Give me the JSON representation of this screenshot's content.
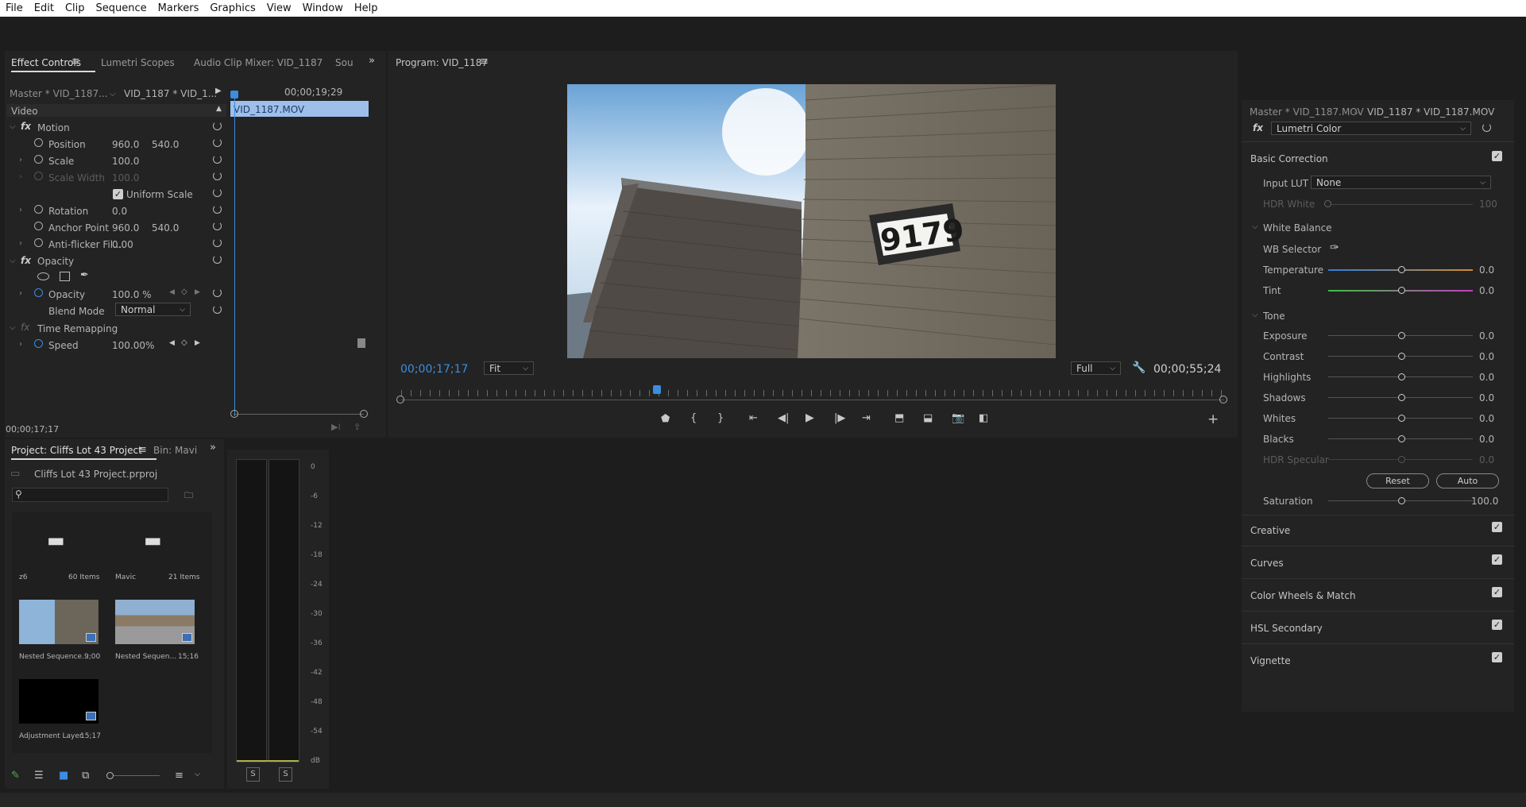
{
  "menu": [
    "File",
    "Edit",
    "Clip",
    "Sequence",
    "Markers",
    "Graphics",
    "View",
    "Window",
    "Help"
  ],
  "effect_controls": {
    "tabs": [
      "Effect Controls",
      "Lumetri Scopes",
      "Audio Clip Mixer: VID_1187",
      "Sou"
    ],
    "master": "Master * VID_1187...",
    "clip": "VID_1187 * VID_1...",
    "timecode_top": "00;00;19;29",
    "clip_bar": "VID_1187.MOV",
    "video_header": "Video",
    "motion": "Motion",
    "position_label": "Position",
    "position_x": "960.0",
    "position_y": "540.0",
    "scale_label": "Scale",
    "scale_value": "100.0",
    "scale_width_label": "Scale Width",
    "scale_width_value": "100.0",
    "uniform_scale": "Uniform Scale",
    "rotation_label": "Rotation",
    "rotation_value": "0.0",
    "anchor_label": "Anchor Point",
    "anchor_x": "960.0",
    "anchor_y": "540.0",
    "antiflicker_label": "Anti-flicker Fil...",
    "antiflicker_value": "0.00",
    "opacity_group": "Opacity",
    "opacity_label": "Opacity",
    "opacity_value": "100.0 %",
    "blend_label": "Blend Mode",
    "blend_value": "Normal",
    "time_remap": "Time Remapping",
    "speed_label": "Speed",
    "speed_value": "100.00%",
    "bottom_timecode": "00;00;17;17"
  },
  "program": {
    "tab": "Program: VID_1187",
    "sign_number": "9179",
    "timecode_current": "00;00;17;17",
    "fit": "Fit",
    "quality": "Full",
    "timecode_duration": "00;00;55;24"
  },
  "project": {
    "tab": "Project: Cliffs Lot 43 Project",
    "tab2": "Bin: Mavi",
    "file": "Cliffs Lot 43 Project.prproj",
    "items": [
      {
        "name": "z6",
        "meta": "60 Items"
      },
      {
        "name": "Mavic",
        "meta": "21 Items"
      },
      {
        "name": "Nested Sequence...",
        "meta": "9;00"
      },
      {
        "name": "Nested Sequen...",
        "meta": "15;16"
      },
      {
        "name": "Adjustment Layer",
        "meta": "15;17"
      }
    ]
  },
  "audio_meter": {
    "scale": [
      "0",
      "-6",
      "-12",
      "-18",
      "-24",
      "-30",
      "-36",
      "-42",
      "-48",
      "-54",
      "dB"
    ],
    "solo_left": "S",
    "solo_right": "S"
  },
  "lumetri": {
    "master": "Master * VID_1187.MOV",
    "clip": "VID_1187 * VID_1187.MOV",
    "effect": "Lumetri Color",
    "basic_correction": "Basic Correction",
    "input_lut_label": "Input LUT",
    "input_lut_value": "None",
    "hdr_white_label": "HDR White",
    "hdr_white_value": "100",
    "white_balance": "White Balance",
    "wb_selector": "WB Selector",
    "temperature_label": "Temperature",
    "temperature_value": "0.0",
    "tint_label": "Tint",
    "tint_value": "0.0",
    "tone": "Tone",
    "exposure_label": "Exposure",
    "exposure_value": "0.0",
    "contrast_label": "Contrast",
    "contrast_value": "0.0",
    "highlights_label": "Highlights",
    "highlights_value": "0.0",
    "shadows_label": "Shadows",
    "shadows_value": "0.0",
    "whites_label": "Whites",
    "whites_value": "0.0",
    "blacks_label": "Blacks",
    "blacks_value": "0.0",
    "hdr_specular_label": "HDR Specular",
    "hdr_specular_value": "0.0",
    "reset_btn": "Reset",
    "auto_btn": "Auto",
    "saturation_label": "Saturation",
    "saturation_value": "100.0",
    "sections": [
      "Creative",
      "Curves",
      "Color Wheels & Match",
      "HSL Secondary",
      "Vignette"
    ]
  }
}
